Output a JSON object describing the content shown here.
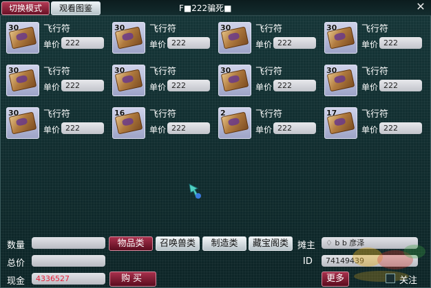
{
  "header": {
    "mode_button": "切换模式",
    "album_button": "观看图鉴",
    "title": "F■222骗死■",
    "close_icon": "close-icon"
  },
  "items": [
    {
      "qty": "30",
      "name": "飞行符",
      "price_label": "单价",
      "price": "222"
    },
    {
      "qty": "30",
      "name": "飞行符",
      "price_label": "单价",
      "price": "222"
    },
    {
      "qty": "30",
      "name": "飞行符",
      "price_label": "单价",
      "price": "222"
    },
    {
      "qty": "30",
      "name": "飞行符",
      "price_label": "单价",
      "price": "222"
    },
    {
      "qty": "30",
      "name": "飞行符",
      "price_label": "单价",
      "price": "222"
    },
    {
      "qty": "30",
      "name": "飞行符",
      "price_label": "单价",
      "price": "222"
    },
    {
      "qty": "30",
      "name": "飞行符",
      "price_label": "单价",
      "price": "222"
    },
    {
      "qty": "30",
      "name": "飞行符",
      "price_label": "单价",
      "price": "222"
    },
    {
      "qty": "30",
      "name": "飞行符",
      "price_label": "单价",
      "price": "222"
    },
    {
      "qty": "16",
      "name": "飞行符",
      "price_label": "单价",
      "price": "222"
    },
    {
      "qty": "2",
      "name": "飞行符",
      "price_label": "单价",
      "price": "222"
    },
    {
      "qty": "17",
      "name": "飞行符",
      "price_label": "单价",
      "price": "222"
    }
  ],
  "footer": {
    "quantity_label": "数量",
    "quantity_value": "",
    "total_label": "总价",
    "total_value": "",
    "cash_label": "现金",
    "cash_value": "4336527",
    "buy_button": "购买",
    "tabs": [
      {
        "label": "物品类",
        "active": true
      },
      {
        "label": "召唤兽类",
        "active": false
      },
      {
        "label": "制造类",
        "active": false
      },
      {
        "label": "藏宝阁类",
        "active": false
      }
    ],
    "seller_label": "摊主",
    "seller_value": "♢ b b 彦泽",
    "id_label": "ID",
    "id_value": "74149439",
    "more_button": "更多",
    "follow_label": "关注"
  },
  "colors": {
    "accent_red": "#a8304c",
    "cash_red": "#e8203a",
    "background": "#0e2a2b"
  }
}
